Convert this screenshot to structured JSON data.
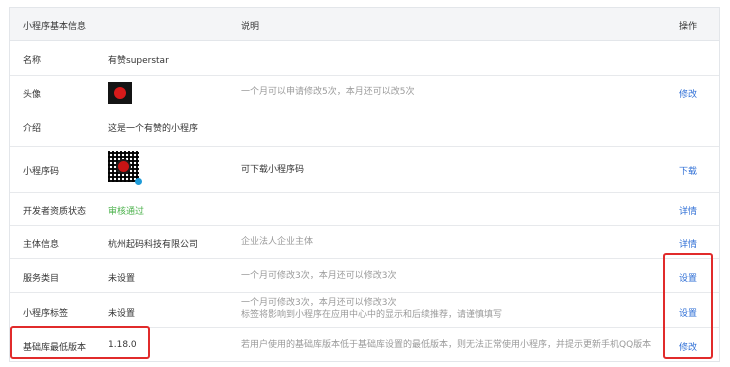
{
  "header": {
    "col_info": "小程序基本信息",
    "col_desc": "说明",
    "col_op": "操作"
  },
  "rows": [
    {
      "label": "名称",
      "value": "有赞superstar",
      "desc": "",
      "op": ""
    },
    {
      "label": "头像",
      "value": "",
      "desc": "一个月可以申请修改5次，本月还可以改5次",
      "op": "修改"
    },
    {
      "label": "介绍",
      "value": "这是一个有赞的小程序",
      "desc": "",
      "op": ""
    },
    {
      "label": "小程序码",
      "value": "",
      "desc": "可下载小程序码",
      "op": "下载"
    },
    {
      "label": "开发者资质状态",
      "value": "审核通过",
      "desc": "",
      "op": "详情"
    },
    {
      "label": "主体信息",
      "value": "杭州起码科技有限公司",
      "desc": "企业法人企业主体",
      "op": "详情"
    },
    {
      "label": "服务类目",
      "value": "未设置",
      "desc": "一个月可修改3次，本月还可以修改3次",
      "op": "设置"
    },
    {
      "label": "小程序标签",
      "value": "未设置",
      "desc": "一个月可修改3次，本月还可以修改3次",
      "desc2": "标签将影响到小程序在应用中心中的显示和后续推荐，请谨慎填写",
      "op": "设置"
    },
    {
      "label": "基础库最低版本",
      "value": "1.18.0",
      "desc": "若用户使用的基础库版本低于基础库设置的最低版本，则无法正常使用小程序，并提示更新手机QQ版本",
      "op": "修改"
    }
  ]
}
